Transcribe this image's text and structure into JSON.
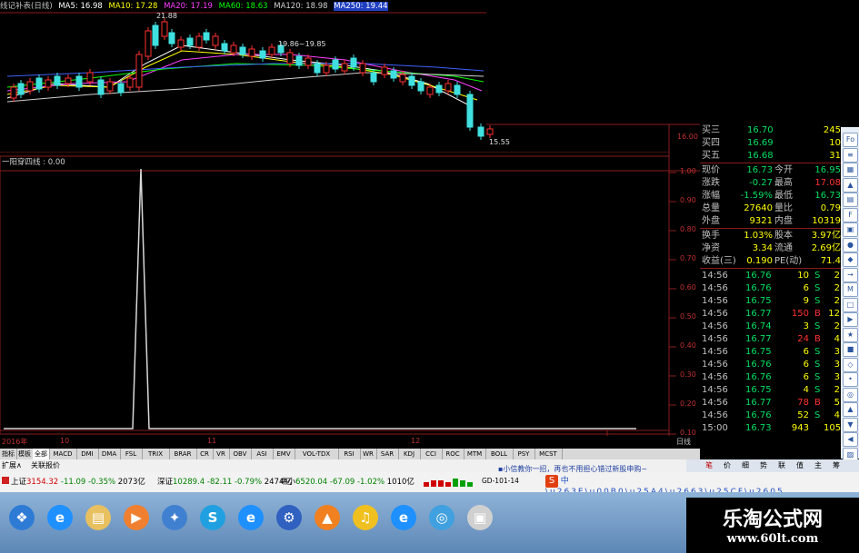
{
  "kline": {
    "title": "线记补表(日线)",
    "ma5": "MA5: 16.98",
    "ma10": "MA10: 17.28",
    "ma20": "MA20: 17.19",
    "ma60": "MA60: 18.63",
    "ma120": "MA120: 18.98",
    "ma250": "MA250: 19.44",
    "high_mark": "21.88",
    "mid_mark": "19.86~19.85",
    "low_mark": "15.55",
    "price_axis_16": "16.00",
    "colors": {
      "ma5": "#ffffff",
      "ma10": "#ffff00",
      "ma20": "#ff40ff",
      "ma60": "#00ff00",
      "ma120": "#ffffff",
      "ma250": "#4060ff"
    }
  },
  "indicator": {
    "title": "一阳穿四线 : 0.00",
    "y_labels": [
      "1.00",
      "0.90",
      "0.80",
      "0.70",
      "0.60",
      "0.50",
      "0.40",
      "0.30",
      "0.20",
      "0.10"
    ],
    "x_labels": [
      "2016年",
      "10",
      "11",
      "12"
    ],
    "x_right": "日线"
  },
  "quote": {
    "buy": [
      {
        "label": "买三",
        "price": "16.70",
        "vol": "245"
      },
      {
        "label": "买四",
        "price": "16.69",
        "vol": "10"
      },
      {
        "label": "买五",
        "price": "16.68",
        "vol": "31"
      }
    ],
    "stats": [
      {
        "l1": "现价",
        "v1": "16.73",
        "l2": "今开",
        "v2": "16.95"
      },
      {
        "l1": "涨跌",
        "v1": "-0.27",
        "l2": "最高",
        "v2": "17.08"
      },
      {
        "l1": "涨幅",
        "v1": "-1.59%",
        "l2": "最低",
        "v2": "16.73"
      },
      {
        "l1": "总量",
        "v1": "27640",
        "l2": "量比",
        "v2": "0.79"
      },
      {
        "l1": "外盘",
        "v1": "9321",
        "l2": "内盘",
        "v2": "10319"
      }
    ],
    "stats2": [
      {
        "l1": "换手",
        "v1": "1.03%",
        "l2": "股本",
        "v2": "3.97亿"
      },
      {
        "l1": "净资",
        "v1": "3.34",
        "l2": "流通",
        "v2": "2.69亿"
      },
      {
        "l1": "收益(三)",
        "v1": "0.190",
        "l2": "PE(动)",
        "v2": "71.4"
      }
    ],
    "ticks": [
      {
        "t": "14:56",
        "p": "16.76",
        "v": "10",
        "s": "S",
        "n": "2"
      },
      {
        "t": "14:56",
        "p": "16.76",
        "v": "6",
        "s": "S",
        "n": "2"
      },
      {
        "t": "14:56",
        "p": "16.75",
        "v": "9",
        "s": "S",
        "n": "2"
      },
      {
        "t": "14:56",
        "p": "16.77",
        "v": "150",
        "s": "B",
        "n": "12"
      },
      {
        "t": "14:56",
        "p": "16.74",
        "v": "3",
        "s": "S",
        "n": "2"
      },
      {
        "t": "14:56",
        "p": "16.77",
        "v": "24",
        "s": "B",
        "n": "4"
      },
      {
        "t": "14:56",
        "p": "16.75",
        "v": "6",
        "s": "S",
        "n": "3"
      },
      {
        "t": "14:56",
        "p": "16.76",
        "v": "6",
        "s": "S",
        "n": "3"
      },
      {
        "t": "14:56",
        "p": "16.76",
        "v": "6",
        "s": "S",
        "n": "3"
      },
      {
        "t": "14:56",
        "p": "16.75",
        "v": "4",
        "s": "S",
        "n": "2"
      },
      {
        "t": "14:56",
        "p": "16.77",
        "v": "78",
        "s": "B",
        "n": "5"
      },
      {
        "t": "14:56",
        "p": "16.76",
        "v": "52",
        "s": "S",
        "n": "4"
      },
      {
        "t": "15:00",
        "p": "16.73",
        "v": "943",
        "s": "",
        "n": "105"
      }
    ]
  },
  "tabs": [
    "指标",
    "模板",
    "全部",
    "MACD",
    "DMI",
    "DMA",
    "FSL",
    "TRIX",
    "BRAR",
    "CR",
    "VR",
    "OBV",
    "ASI",
    "EMV",
    "VOL-TDX",
    "RSI",
    "WR",
    "SAR",
    "KDJ",
    "CCI",
    "ROC",
    "MTM",
    "BOLL",
    "PSY",
    "MCST"
  ],
  "ext_tabs": [
    "扩展∧",
    "关联报价"
  ],
  "right_tabs": [
    "笔",
    "价",
    "细",
    "势",
    "联",
    "值",
    "主",
    "筹"
  ],
  "side_buttons": [
    "Fo",
    "≡",
    "▦",
    "▲",
    "▤",
    "F",
    "▣",
    "●",
    "◆",
    "→",
    "M",
    "□",
    "▶",
    "★",
    "■",
    "◇",
    "•",
    "◎",
    "▲",
    "▼",
    "◀",
    "▨"
  ],
  "status": {
    "sh_label": "上证",
    "sh_val": "3154.32",
    "sh_chg": "-11.09",
    "sh_pct": "-0.35%",
    "sh_amt": "2073亿",
    "sz_label": "深证",
    "sz_val": "10289.4",
    "sz_chg": "-82.11",
    "sz_pct": "-0.79%",
    "sz_amt": "2474亿",
    "zx_label": "中小",
    "zx_val": "6520.04",
    "zx_chg": "-67.09",
    "zx_pct": "-1.02%",
    "zx_amt": "1010亿",
    "code": "GD-101-14",
    "ticker": "▪小信教你一招，再也不用担心错过新股申购~"
  },
  "watermark": {
    "line1": "乐淘公式网",
    "line2": "www.60lt.com"
  },
  "taskbar_icons": [
    "start-orb-icon",
    "ie-icon",
    "explorer-icon",
    "media-player-icon",
    "network-icon",
    "skype-icon",
    "ie-icon",
    "tools-icon",
    "vlc-icon",
    "music-icon",
    "ie-icon",
    "browser-icon",
    "stock-app-icon"
  ]
}
